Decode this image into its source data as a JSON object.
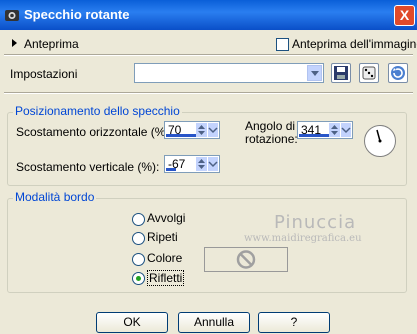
{
  "window": {
    "title": "Specchio rotante",
    "close_glyph": "X"
  },
  "preview": {
    "toggle_label": "Anteprima",
    "image_preview_label": "Anteprima dell'immagine",
    "image_preview_checked": false
  },
  "settings": {
    "label": "Impostazioni",
    "value": ""
  },
  "mirror_group": {
    "title": "Posizionamento dello specchio",
    "h_offset_label": "Scostamento orizzontale (%):",
    "h_offset_value": "70",
    "v_offset_label": "Scostamento verticale (%):",
    "v_offset_value": "-67",
    "angle_label_1": "Angolo di",
    "angle_label_2": "rotazione:",
    "angle_value": "341"
  },
  "border_group": {
    "title": "Modalità bordo",
    "options": [
      "Avvolgi",
      "Ripeti",
      "Colore",
      "Rifletti"
    ],
    "selected": "Rifletti"
  },
  "watermark": {
    "name": "Pinuccia",
    "url": "www.maidiregrafica.eu"
  },
  "buttons": {
    "ok": "OK",
    "cancel": "Annulla",
    "help": "?"
  }
}
